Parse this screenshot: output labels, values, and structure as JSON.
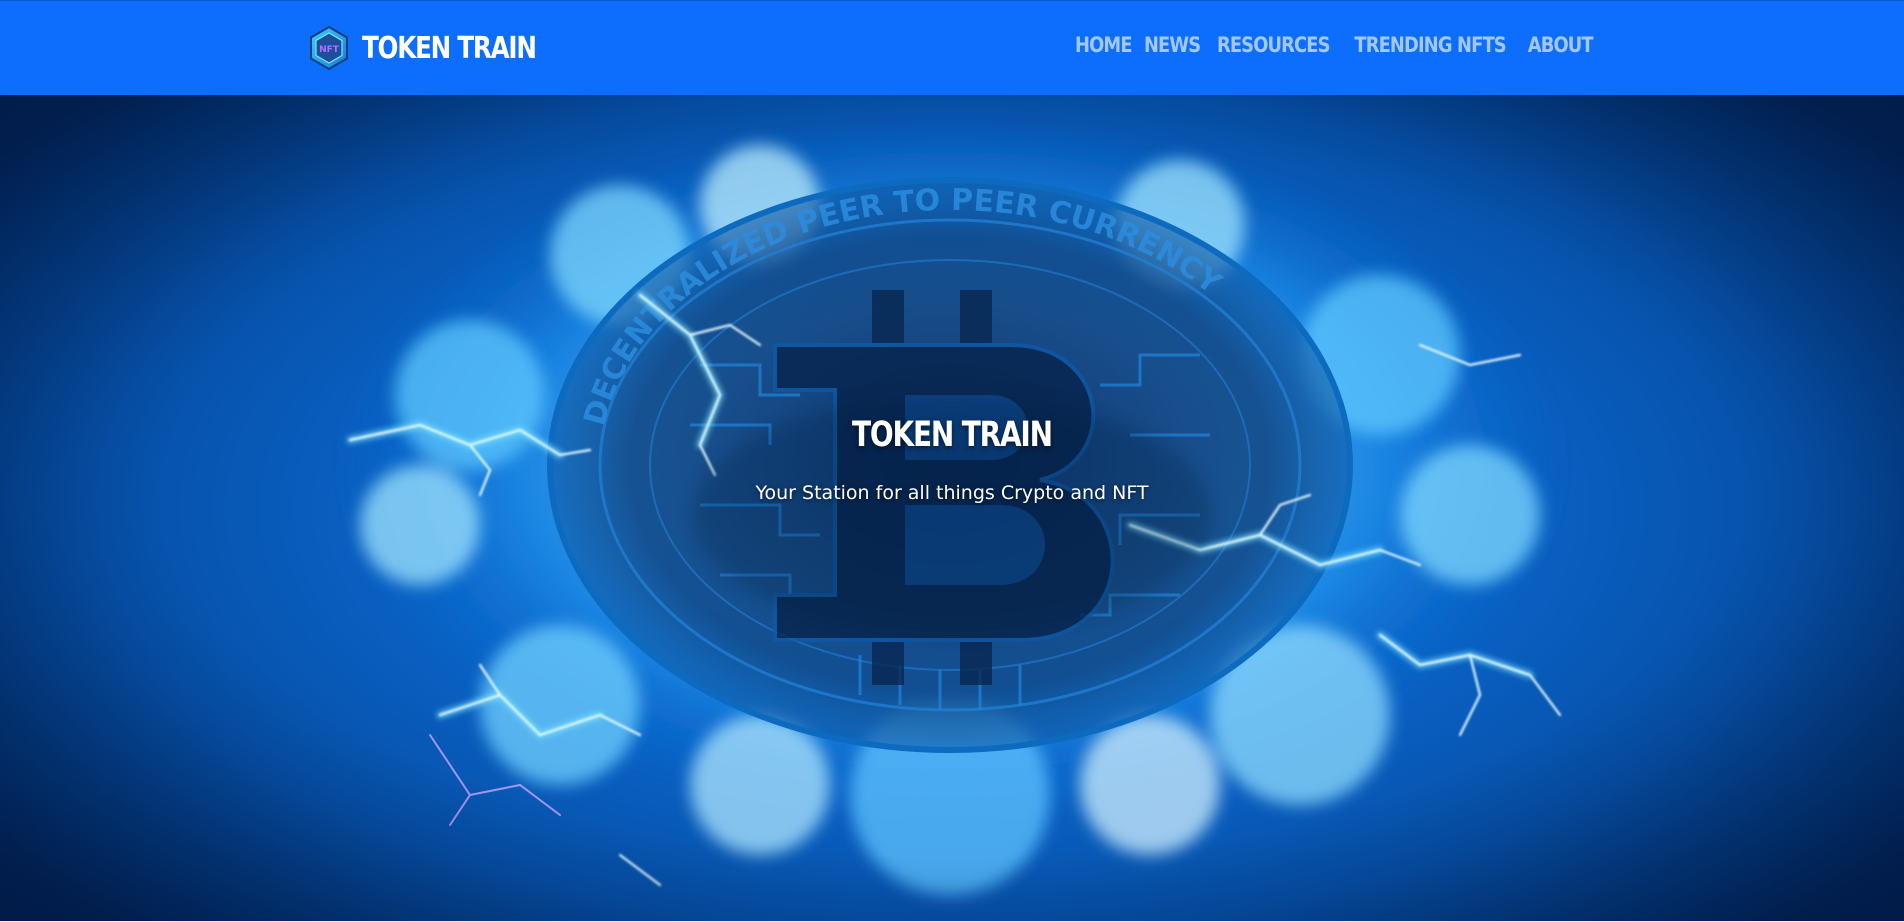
{
  "brand": {
    "logo_text": "NFT",
    "name": "TOKEN TRAIN"
  },
  "nav": {
    "items": [
      {
        "label": "HOME"
      },
      {
        "label": "NEWS"
      },
      {
        "label": "RESOURCES"
      },
      {
        "label": "TRENDING NFTS"
      },
      {
        "label": "ABOUT"
      }
    ]
  },
  "hero": {
    "title": "TOKEN TRAIN",
    "subtitle": "Your Station for all things Crypto and NFT",
    "coin_ring_text": "DECENTRALIZED PEER TO PEER CURRENCY"
  },
  "colors": {
    "navbar": "#0d6efd",
    "nav_link": "#a8c8ff",
    "hero_glow": "#4fc3ff"
  },
  "icons": {
    "brand_logo": "nft-hexagon-icon",
    "hero_coin": "bitcoin-icon"
  }
}
